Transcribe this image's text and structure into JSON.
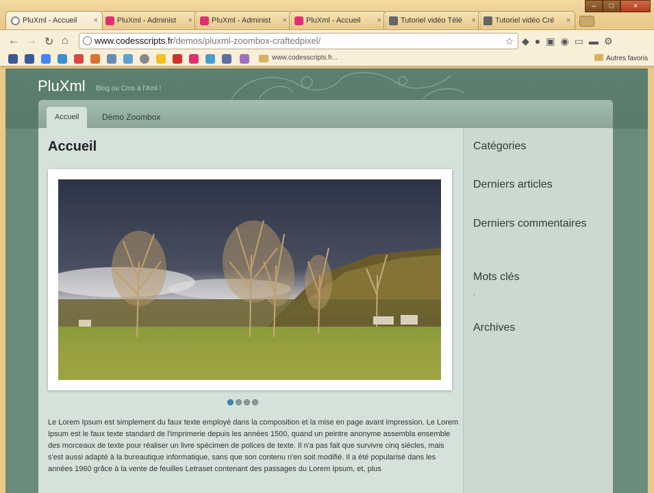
{
  "browser": {
    "tabs": [
      {
        "label": "PluXml - Accueil",
        "icon": "clock-favicon"
      },
      {
        "label": "PluXml - Administ",
        "icon": "pluxml-favicon"
      },
      {
        "label": "PluXml - Administ",
        "icon": "pluxml-favicon"
      },
      {
        "label": "PluXml - Accueil",
        "icon": "pluxml-favicon"
      },
      {
        "label": "Tutoriel vidéo Télé",
        "icon": "video-favicon"
      },
      {
        "label": "Tutoriel vidéo Cré",
        "icon": "video-favicon"
      }
    ],
    "close_glyph": "×",
    "url_host": "www.codesscripts.fr",
    "url_path": "/demos/pluxml-zoombox-craftedpixel/",
    "bookmark_text": "www.codesscripts.fr...",
    "other_bookmarks": "Autres favoris"
  },
  "site": {
    "title": "PluXml",
    "description": "Blog ou Cms à l'Xml !",
    "nav": [
      "Accueil",
      "Démo Zoombox"
    ],
    "heading": "Accueil",
    "slider_dots": 4,
    "slider_active": 0,
    "paragraph": "Le Lorem Ipsum est simplement du faux texte employé dans la composition et la mise en page avant impression. Le Lorem Ipsum est le faux texte standard de l'imprimerie depuis les années 1500, quand un peintre anonyme assembla ensemble des morceaux de texte pour réaliser un livre spécimen de polices de texte. Il n'a pas fait que survivre cinq siècles, mais s'est aussi adapté à la bureautique informatique, sans que son contenu n'en soit modifié. Il a été popularisé dans les années 1960 grâce à la vente de feuilles Letraset contenant des passages du Lorem Ipsum, et, plus"
  },
  "sidebar": {
    "categories": "Catégories",
    "latest_articles": "Derniers articles",
    "latest_comments": "Derniers commentaires",
    "tags": "Mots clés",
    "tags_marker": "›",
    "archives": "Archives"
  },
  "colors": {
    "page_bg": "#5a7a6c",
    "frame_bg": "#d5e1da",
    "sidebar_bg": "#cbd9d1",
    "slider_dot_active": "#3a8ab8"
  }
}
